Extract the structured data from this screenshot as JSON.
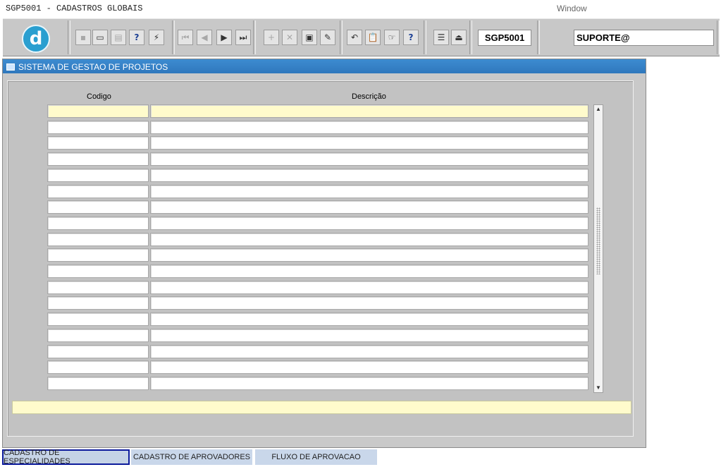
{
  "window": {
    "title": "SGP5001 - CADASTROS GLOBAIS",
    "menu_window": "Window"
  },
  "toolbar": {
    "logo_text": "d",
    "buttons": [
      {
        "name": "save-icon",
        "glyph": "▪",
        "disabled": true
      },
      {
        "name": "window-icon",
        "glyph": "▭"
      },
      {
        "name": "print-icon",
        "glyph": "▤",
        "disabled": true
      },
      {
        "name": "query-icon",
        "glyph": "?"
      },
      {
        "name": "execute-query-icon",
        "glyph": "⚡"
      },
      {
        "name": "first-record-icon",
        "glyph": "⏮",
        "disabled": true
      },
      {
        "name": "previous-record-icon",
        "glyph": "◀",
        "disabled": true
      },
      {
        "name": "next-record-icon",
        "glyph": "▶"
      },
      {
        "name": "last-record-icon",
        "glyph": "⏭"
      },
      {
        "name": "insert-record-icon",
        "glyph": "+",
        "disabled": true
      },
      {
        "name": "delete-record-icon",
        "glyph": "✕",
        "disabled": true
      },
      {
        "name": "lov-icon",
        "glyph": "▣"
      },
      {
        "name": "edit-icon",
        "glyph": "✎"
      },
      {
        "name": "undo-icon",
        "glyph": "↶"
      },
      {
        "name": "clipboard-icon",
        "glyph": "📋",
        "disabled": true
      },
      {
        "name": "hand-icon",
        "glyph": "☞"
      },
      {
        "name": "help-icon",
        "glyph": "?"
      },
      {
        "name": "menu-icon",
        "glyph": "☰"
      },
      {
        "name": "exit-icon",
        "glyph": "⏏"
      }
    ],
    "form_name": "SGP5001",
    "user_name": "SUPORTE@"
  },
  "form": {
    "title": "SISTEMA DE GESTAO DE PROJETOS",
    "columns": {
      "codigo": "Codigo",
      "descricao": "Descrição"
    },
    "row_count": 18
  },
  "tabs": [
    {
      "label": "CADASTRO DE ESPECIALIDADES",
      "active": true
    },
    {
      "label": "CADASTRO DE APROVADORES",
      "active": false
    },
    {
      "label": "FLUXO DE APROVACAO",
      "active": false
    }
  ],
  "colors": {
    "title_bar": "#3d8cd0",
    "current_row": "#fffbcc",
    "active_tab_border": "#0d1b9c"
  }
}
